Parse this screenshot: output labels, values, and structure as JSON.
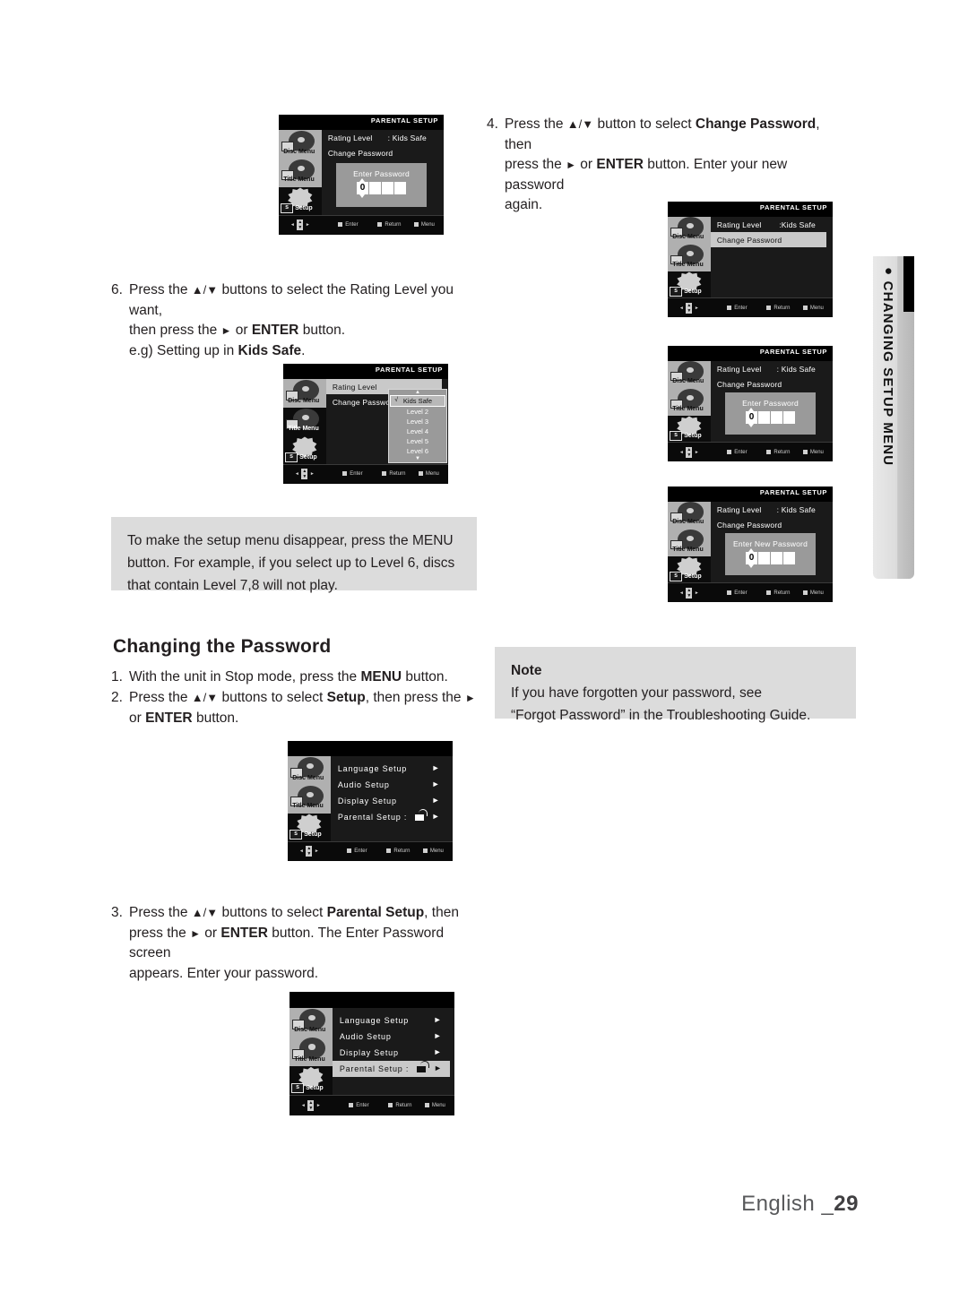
{
  "page": {
    "footer_lang": "English _",
    "footer_number": "29",
    "side_tab": "CHANGING SETUP MENU"
  },
  "steps": {
    "step4": {
      "num": "4.",
      "line1_a": "Press the ",
      "line1_arrows": "▲/▼",
      "line1_b": " button to select ",
      "line1_bold": "Change Password",
      "line1_c": ", then",
      "line2_a": "press the ",
      "line2_arrow": "►",
      "line2_b": " or ",
      "line2_bold": "ENTER",
      "line2_c": " button. Enter your new password",
      "line3": "again."
    },
    "step6": {
      "num": "6.",
      "line1_a": "Press the ",
      "line1_arrows": "▲/▼",
      "line1_b": " buttons to select the Rating Level you want,",
      "line2_a": "then press the ",
      "line2_arrow": "►",
      "line2_b": " or ",
      "line2_bold": "ENTER",
      "line2_c": " button.",
      "line3_a": "e.g) Setting up in ",
      "line3_bold": "Kids Safe",
      "line3_c": "."
    },
    "step1": {
      "num": "1.",
      "line1_a": "With the unit in Stop mode, press the ",
      "line1_bold": "MENU",
      "line1_b": " button."
    },
    "step2": {
      "num": "2.",
      "line1_a": "Press the ",
      "line1_arrows": "▲/▼",
      "line1_b": " buttons to select ",
      "line1_bold": "Setup",
      "line1_c": ", then press the ",
      "line1_arrow": "►",
      "line2_a": "or ",
      "line2_bold": "ENTER",
      "line2_b": " button."
    },
    "step3": {
      "num": "3.",
      "line1_a": "Press the ",
      "line1_arrows": "▲/▼",
      "line1_b": " buttons to select ",
      "line1_bold": "Parental Setup",
      "line1_c": ", then",
      "line2_a": "press the ",
      "line2_arrow": "►",
      "line2_b": " or ",
      "line2_bold": "ENTER",
      "line2_c": " button. The Enter Password screen",
      "line3": "appears. Enter your password."
    }
  },
  "notes": {
    "menu_note": {
      "line1": "To make the setup menu disappear, press the MENU",
      "line2": "button. For example, if you select up to Level 6, discs",
      "line3": "that contain Level 7,8 will not play."
    },
    "forgot_note": {
      "title": "Note",
      "line1": "If you have forgotten your password, see",
      "line2": "“Forgot Password” in the Troubleshooting Guide."
    }
  },
  "section": {
    "changing_password_heading": "Changing the Password"
  },
  "osd_common": {
    "title_parental": "PARENTAL SETUP",
    "side_buttons": {
      "disc_menu": "Disc Menu",
      "title_menu": "Title Menu",
      "setup": "Setup",
      "setup_badge": "S"
    },
    "bottom_bar": {
      "enter": "Enter",
      "return": "Return",
      "menu": "Menu"
    },
    "rating_level_label": "Rating Level",
    "change_password_label": "Change Password",
    "change_password_truncated": "Change Passwor",
    "kids_safe_value": ": Kids Safe",
    "kids_safe_value_tight": ":Kids Safe",
    "enter_password_label": "Enter Password",
    "enter_new_password_label": "Enter New Password",
    "password_digit": "0"
  },
  "rating_dropdown": {
    "scroll_up": "▲",
    "scroll_down": "▼",
    "check": "√",
    "items": [
      "Kids Safe",
      "Level 2",
      "Level 3",
      "Level 4",
      "Level 5",
      "Level 6"
    ]
  },
  "setup_menu": {
    "items": [
      "Language Setup",
      "Audio Setup",
      "Display Setup",
      "Parental Setup :"
    ],
    "arrow": "►"
  }
}
